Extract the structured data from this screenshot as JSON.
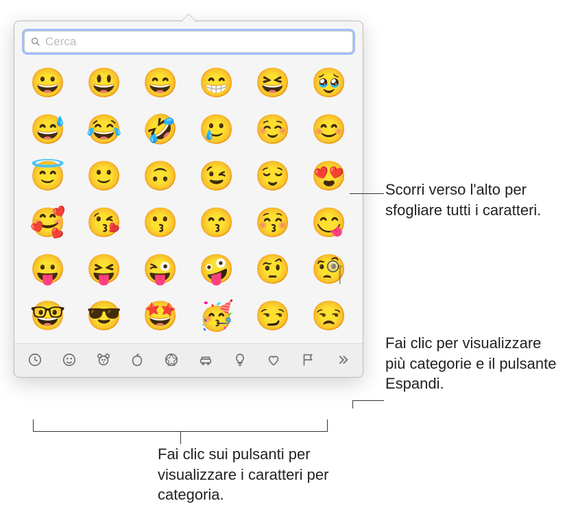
{
  "search": {
    "placeholder": "Cerca",
    "value": ""
  },
  "emoji_grid": [
    [
      "😀",
      "😃",
      "😄",
      "😁",
      "😆",
      "🥹"
    ],
    [
      "😅",
      "😂",
      "🤣",
      "🥲",
      "☺️",
      "😊"
    ],
    [
      "😇",
      "🙂",
      "🙃",
      "😉",
      "😌",
      "😍"
    ],
    [
      "🥰",
      "😘",
      "😗",
      "😙",
      "😚",
      "😋"
    ],
    [
      "😛",
      "😝",
      "😜",
      "🤪",
      "🤨",
      "🧐"
    ],
    [
      "🤓",
      "😎",
      "🤩",
      "🥳",
      "😏",
      "😒"
    ]
  ],
  "categories": [
    {
      "id": "recent",
      "label": "Recenti"
    },
    {
      "id": "smileys",
      "label": "Faccine"
    },
    {
      "id": "animals",
      "label": "Animali e natura"
    },
    {
      "id": "food",
      "label": "Cibo e bevande"
    },
    {
      "id": "activity",
      "label": "Attività"
    },
    {
      "id": "travel",
      "label": "Viaggi e luoghi"
    },
    {
      "id": "objects",
      "label": "Oggetti"
    },
    {
      "id": "symbols",
      "label": "Simboli"
    },
    {
      "id": "flags",
      "label": "Bandiere"
    },
    {
      "id": "more",
      "label": "Altro"
    }
  ],
  "callouts": {
    "scroll": "Scorri verso l'alto per sfogliare tutti i caratteri.",
    "expand": "Fai clic per visualizzare più categorie e il pulsante Espandi.",
    "categories": "Fai clic sui pulsanti per visualizzare i caratteri per categoria."
  }
}
